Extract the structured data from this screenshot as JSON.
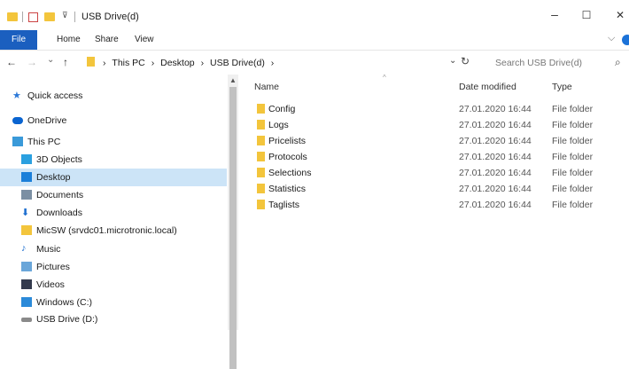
{
  "titlebar": {
    "title": "USB Drive(d)",
    "minimize": "–",
    "maximize": "☐",
    "close": "✕"
  },
  "ribbon": {
    "file": "File",
    "tabs": [
      "Home",
      "Share",
      "View"
    ],
    "expand": "⌵"
  },
  "nav": {
    "back": "←",
    "forward": "→",
    "recent": "⌄",
    "up": "↑"
  },
  "address": {
    "crumbs": [
      "This PC",
      "Desktop",
      "USB Drive(d)"
    ],
    "separator": "›",
    "dropdown": "⌄",
    "refresh": "↻"
  },
  "search": {
    "placeholder": "Search USB Drive(d)",
    "icon": "⌕"
  },
  "sidebar": {
    "items": [
      {
        "label": "Quick access",
        "icon": "star-icon",
        "color": "#2b78d8"
      },
      {
        "label": "OneDrive",
        "icon": "cloud-icon",
        "color": "#0a64d0"
      },
      {
        "label": "This PC",
        "icon": "computer-icon",
        "color": "#3a9ad9"
      },
      {
        "label": "3D Objects",
        "icon": "cube-icon",
        "color": "#2aa0e0"
      },
      {
        "label": "Desktop",
        "icon": "desktop-icon",
        "color": "#1a7fd9",
        "selected": true
      },
      {
        "label": "Documents",
        "icon": "document-icon",
        "color": "#7b8fa3"
      },
      {
        "label": "Downloads",
        "icon": "download-icon",
        "color": "#1e6fd0"
      },
      {
        "label": "MicSW (srvdc01.microtronic.local)",
        "icon": "network-drive-icon",
        "color": "#f3c53c"
      },
      {
        "label": "Music",
        "icon": "music-icon",
        "color": "#1e6fd0"
      },
      {
        "label": "Pictures",
        "icon": "pictures-icon",
        "color": "#6aa6d9"
      },
      {
        "label": "Videos",
        "icon": "videos-icon",
        "color": "#333a4d"
      },
      {
        "label": "Windows (C:)",
        "icon": "windows-drive-icon",
        "color": "#2b8ad9"
      },
      {
        "label": "USB Drive (D:)",
        "icon": "usb-drive-icon",
        "color": "#8a8a8a"
      }
    ]
  },
  "table": {
    "headers": {
      "name": "Name",
      "date": "Date modified",
      "type": "Type"
    },
    "rows": [
      {
        "name": "Config",
        "date": "27.01.2020 16:44",
        "type": "File folder"
      },
      {
        "name": "Logs",
        "date": "27.01.2020 16:44",
        "type": "File folder"
      },
      {
        "name": "Pricelists",
        "date": "27.01.2020 16:44",
        "type": "File folder"
      },
      {
        "name": "Protocols",
        "date": "27.01.2020 16:44",
        "type": "File folder"
      },
      {
        "name": "Selections",
        "date": "27.01.2020 16:44",
        "type": "File folder"
      },
      {
        "name": "Statistics",
        "date": "27.01.2020 16:44",
        "type": "File folder"
      },
      {
        "name": "Taglists",
        "date": "27.01.2020 16:44",
        "type": "File folder"
      }
    ]
  },
  "colors": {
    "accent": "#1b5fbf",
    "selection": "#cce4f7",
    "folder": "#f3c53c"
  }
}
